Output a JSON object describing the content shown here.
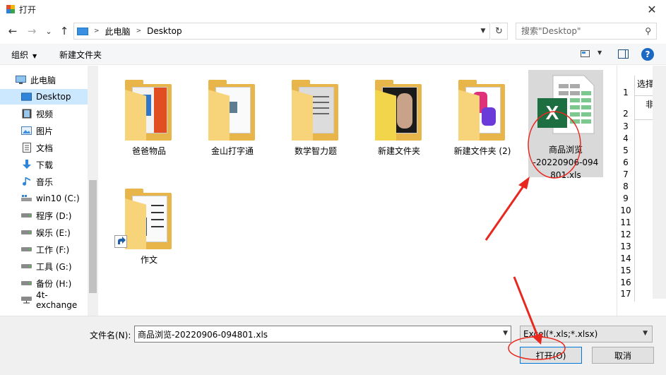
{
  "window": {
    "title": "打开",
    "close_glyph": "✕"
  },
  "nav": {
    "back_glyph": "←",
    "forward_glyph": "→",
    "recent_glyph": "⌄",
    "up_glyph": "↑",
    "breadcrumbs": [
      "此电脑",
      "Desktop"
    ],
    "refresh_glyph": "↻",
    "search_placeholder": "搜索\"Desktop\""
  },
  "toolbar": {
    "organize": "组织",
    "new_folder": "新建文件夹",
    "help_glyph": "?"
  },
  "sidebar": {
    "items": [
      {
        "label": "此电脑",
        "icon": "pc-icon"
      },
      {
        "label": "Desktop",
        "icon": "desktop-icon",
        "selected": true
      },
      {
        "label": "视频",
        "icon": "video-icon"
      },
      {
        "label": "图片",
        "icon": "picture-icon"
      },
      {
        "label": "文档",
        "icon": "document-icon"
      },
      {
        "label": "下载",
        "icon": "download-icon"
      },
      {
        "label": "音乐",
        "icon": "music-icon"
      },
      {
        "label": "win10 (C:)",
        "icon": "drive-icon"
      },
      {
        "label": "程序 (D:)",
        "icon": "drive-icon"
      },
      {
        "label": "娱乐 (E:)",
        "icon": "drive-icon"
      },
      {
        "label": "工作 (F:)",
        "icon": "drive-icon"
      },
      {
        "label": "工具 (G:)",
        "icon": "drive-icon"
      },
      {
        "label": "备份 (H:)",
        "icon": "drive-icon"
      },
      {
        "label": "4t-exchange",
        "icon": "network-drive-icon"
      }
    ]
  },
  "files": [
    {
      "name": "爸爸物品",
      "type": "folder"
    },
    {
      "name": "金山打字通",
      "type": "folder"
    },
    {
      "name": "数学智力题",
      "type": "folder"
    },
    {
      "name": "新建文件夹",
      "type": "folder"
    },
    {
      "name": "新建文件夹 (2)",
      "type": "folder"
    },
    {
      "name_lines": [
        "商品浏览",
        "-20220906-094",
        "801.xls"
      ],
      "type": "excel",
      "selected": true
    },
    {
      "name": "作文",
      "type": "folder-shortcut"
    }
  ],
  "preview": {
    "header": "选择",
    "cell": "非",
    "rows": [
      "1",
      "2",
      "3",
      "4",
      "5",
      "6",
      "7",
      "8",
      "9",
      "10",
      "11",
      "12",
      "13",
      "14",
      "15",
      "16",
      "17"
    ]
  },
  "bottom": {
    "filename_label": "文件名(N):",
    "filename_value": "商品浏览-20220906-094801.xls",
    "filetype_value": "Excel(*.xls;*.xlsx)",
    "open_label": "打开(O)",
    "cancel_label": "取消"
  },
  "colors": {
    "selection": "#cce8ff",
    "annotation": "#e8271f",
    "excel_green": "#1d6f42"
  }
}
